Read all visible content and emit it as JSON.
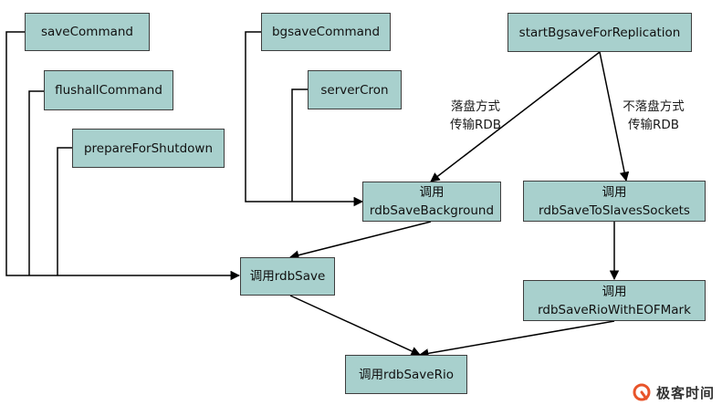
{
  "nodes": {
    "save_command": "saveCommand",
    "flushall_command": "flushallCommand",
    "prepare_for_shutdown": "prepareForShutdown",
    "bgsave_command": "bgsaveCommand",
    "server_cron": "serverCron",
    "start_bgsave_for_replication": "startBgsaveForReplication",
    "rdb_save_background": {
      "line1": "调用",
      "line2": "rdbSaveBackground"
    },
    "rdb_save_to_slaves_sockets": {
      "line1": "调用",
      "line2": "rdbSaveToSlavesSockets"
    },
    "rdb_save": "调用rdbSave",
    "rdb_save_rio_with_eof_mark": {
      "line1": "调用",
      "line2": "rdbSaveRioWithEOFMark"
    },
    "rdb_save_rio": "调用rdbSaveRio"
  },
  "edge_labels": {
    "disk_transfer": {
      "line1": "落盘方式",
      "line2": "传输RDB"
    },
    "diskless_transfer": {
      "line1": "不落盘方式",
      "line2": "传输RDB"
    }
  },
  "brand": {
    "name": "极客时间",
    "icon": "geektime-logo-icon",
    "color": "#e8542a"
  },
  "colors": {
    "node_fill": "#a8d0cd",
    "node_border": "#3e3e3e",
    "connector": "#000000"
  }
}
